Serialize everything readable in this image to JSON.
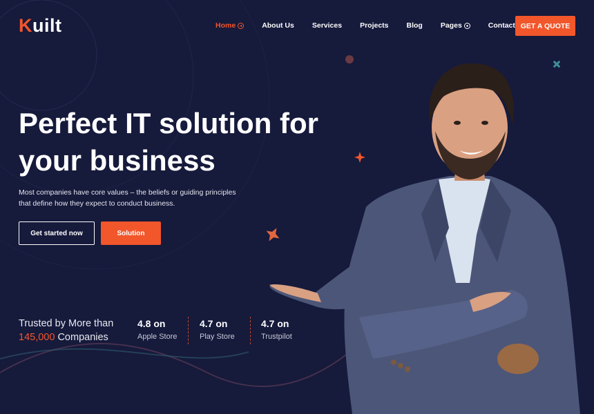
{
  "brand": {
    "logo_first": "K",
    "logo_rest": "uilt"
  },
  "nav": {
    "items": [
      {
        "label": "Home",
        "active": true,
        "has_icon": true
      },
      {
        "label": "About Us",
        "active": false,
        "has_icon": false
      },
      {
        "label": "Services",
        "active": false,
        "has_icon": false
      },
      {
        "label": "Projects",
        "active": false,
        "has_icon": false
      },
      {
        "label": "Blog",
        "active": false,
        "has_icon": false
      },
      {
        "label": "Pages",
        "active": false,
        "has_icon": true
      },
      {
        "label": "Contact Us",
        "active": false,
        "has_icon": false
      }
    ],
    "cta": "GET A QUOTE"
  },
  "hero": {
    "title": "Perfect IT solution for your business",
    "text": "Most companies have core values – the beliefs or guiding principles that define how they expect to conduct business.",
    "primary_button": "Get started now",
    "secondary_button": "Solution"
  },
  "trust": {
    "line1": "Trusted by More than",
    "count": "145,000",
    "companies": "Companies",
    "stats": [
      {
        "value": "4.8 on",
        "label": "Apple Store"
      },
      {
        "value": "4.7 on",
        "label": "Play Store"
      },
      {
        "value": "4.7 on",
        "label": "Trustpilot"
      }
    ]
  },
  "colors": {
    "background": "#161a3b",
    "accent": "#f2562b"
  }
}
